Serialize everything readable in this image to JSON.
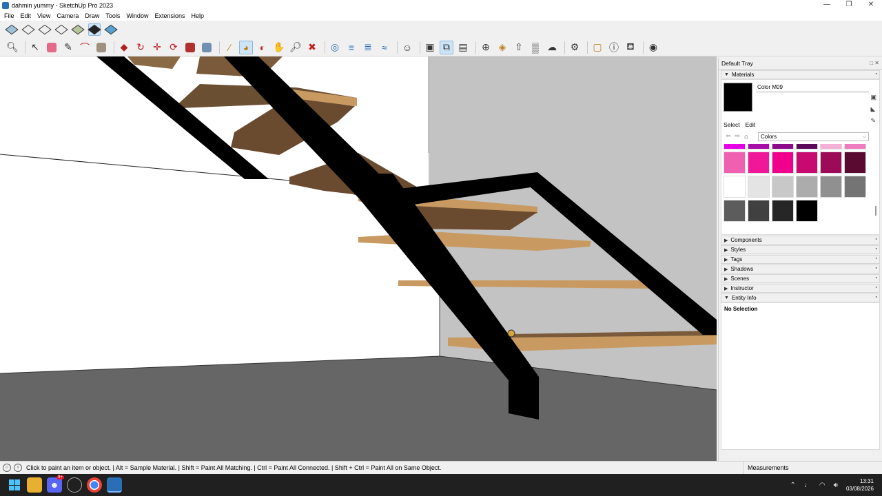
{
  "window": {
    "title": "dahmin yummy - SketchUp Pro 2023",
    "controls": [
      "—",
      "❐",
      "✕"
    ]
  },
  "menu": [
    "File",
    "Edit",
    "View",
    "Camera",
    "Draw",
    "Tools",
    "Window",
    "Extensions",
    "Help"
  ],
  "toolbar1": {
    "icons": [
      "iso-view-icon",
      "top-view-icon",
      "front-view-icon",
      "right-view-icon",
      "back-view-icon",
      "left-view-icon",
      "bottom-view-icon"
    ],
    "selected_index": 5
  },
  "toolbar2": {
    "selected_tool": "paint-bucket"
  },
  "tray": {
    "title": "Default Tray",
    "materials": {
      "header": "Materials",
      "name": "Color M09",
      "preview_color": "#000000",
      "tab_select": "Select",
      "tab_edit": "Edit",
      "library": "Colors",
      "swatches": [
        [
          "#e600e6",
          "#a80ea8",
          "#8b0b8b",
          "#5a0a5a",
          "#f5b0d8",
          "#f07cc0"
        ],
        [
          "#f060b0",
          "#f01898",
          "#f0008c",
          "#c80a70",
          "#9c0a58",
          "#5a0a30"
        ],
        [
          "#ffffff",
          "#e4e4e4",
          "#c8c8c8",
          "#acacac",
          "#909090",
          "#747474"
        ],
        [
          "#5c5c5c",
          "#404040",
          "#262626",
          "#000000"
        ]
      ]
    },
    "panels": [
      "Components",
      "Styles",
      "Tags",
      "Shadows",
      "Scenes",
      "Instructor"
    ],
    "entity_info": {
      "header": "Entity Info",
      "body": "No Selection"
    }
  },
  "status": {
    "text": "Click to paint an item or object. | Alt = Sample Material. | Shift = Paint All Matching. | Ctrl = Paint All Connected. | Shift + Ctrl = Paint All on Same Object.",
    "measurements_label": "Measurements"
  },
  "taskbar": {
    "discord_badge": "9+",
    "time": "13:31",
    "date": "03/08/2026"
  }
}
